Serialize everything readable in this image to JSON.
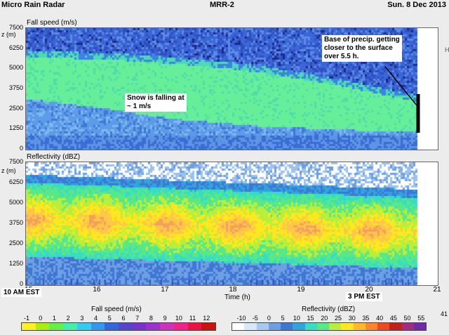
{
  "header": {
    "left": "Micro Rain Radar",
    "center": "MRR-2",
    "right": "Sun.  8 Dec 2013"
  },
  "chart_data": [
    {
      "type": "heatmap",
      "title": "Fall speed (m/s)",
      "ylabel": "z (m)",
      "ylim": [
        0,
        7500
      ],
      "y_ticks": [
        "7500",
        "6250",
        "5000",
        "3750",
        "2500",
        "1250",
        "0"
      ],
      "description_bands": {
        "precip_top_m": [
          5800,
          5700,
          5600,
          5500,
          5300,
          5100,
          4800,
          4400,
          4000,
          3500,
          3000
        ],
        "cloud_base_m": [
          3200,
          2900,
          2600,
          2200,
          1900,
          1700,
          1500,
          1400,
          1300,
          1200,
          1200
        ]
      },
      "annotations": [
        "Snow is falling at\n~ 1 m/s",
        "Base of precip. getting\ncloser to the surface\nover 5.5 h."
      ]
    },
    {
      "type": "heatmap",
      "title": "Reflectivity (dBZ)",
      "ylabel": "z (m)",
      "ylim": [
        0,
        7500
      ],
      "y_ticks": [
        "7500",
        "6250",
        "5000",
        "3750",
        "2500",
        "1250",
        "0"
      ],
      "xlabel": "Time (h)",
      "x_ticks": [
        "15",
        "16",
        "17",
        "18",
        "19",
        "20",
        "21"
      ],
      "xlim": [
        14.95,
        21.0
      ],
      "start_label": "10 AM EST",
      "end_label": "3 PM EST"
    }
  ],
  "colorbars": {
    "fall_speed": {
      "title": "Fall speed (m/s)",
      "ticks": [
        "-1",
        "0",
        "1",
        "2",
        "3",
        "4",
        "5",
        "6",
        "7",
        "8",
        "9",
        "10",
        "11",
        "12"
      ],
      "colors": [
        "#ffee22",
        "#aaee11",
        "#66ee44",
        "#44eeaa",
        "#33ccee",
        "#3399ee",
        "#3366dd",
        "#5544cc",
        "#7733cc",
        "#9933cc",
        "#cc33bb",
        "#ee2288",
        "#ee1144",
        "#cc1111"
      ]
    },
    "reflectivity": {
      "title": "Reflectivity (dBZ)",
      "ticks": [
        "-10",
        "-5",
        "0",
        "5",
        "10",
        "15",
        "20",
        "25",
        "30",
        "35",
        "40",
        "45",
        "50",
        "55"
      ],
      "colors": [
        "#ffffff",
        "#d8e8f8",
        "#a8c8ee",
        "#6e9fe3",
        "#3f77d5",
        "#2fa5dd",
        "#38dcc5",
        "#58e887",
        "#b8ee3c",
        "#ffe81f",
        "#ffb92a",
        "#ff852d",
        "#ee4a22",
        "#c41f1f",
        "#a02d84",
        "#6f2aa8"
      ]
    }
  },
  "right_edge": {
    "top_tick": "H",
    "corner": "41"
  }
}
